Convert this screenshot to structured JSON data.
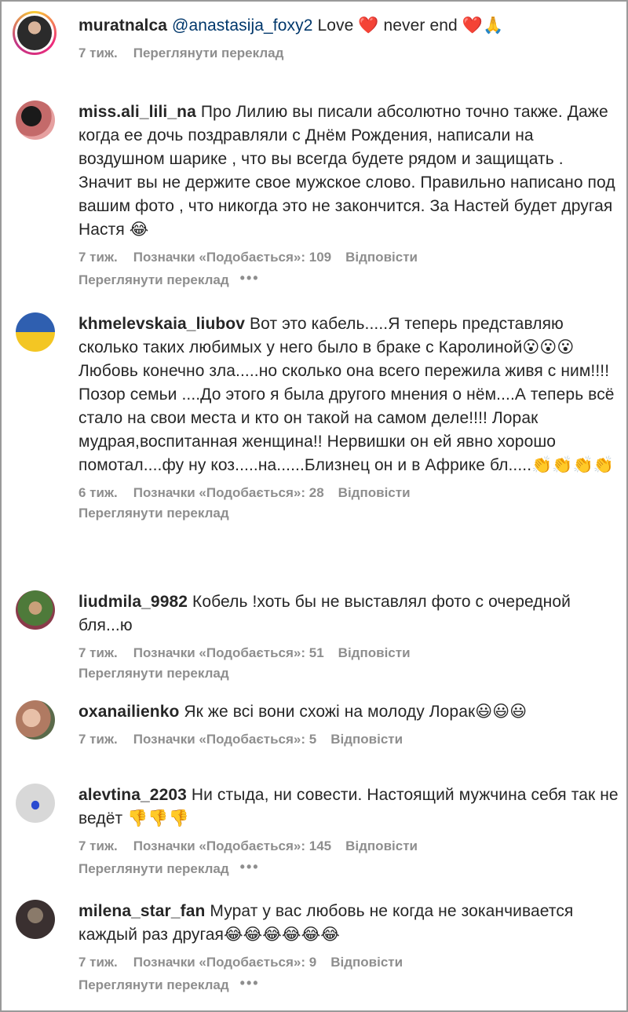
{
  "comments": [
    {
      "user": "muratnalca",
      "mention": "@anastasija_foxy2",
      "text": "Love ❤️ never end ❤️🙏",
      "time": "7 тиж.",
      "likes": "",
      "reply": "",
      "translate": "Переглянути переклад",
      "avatar_color": "#2b2b2b"
    },
    {
      "user": "miss.ali_lili_na",
      "text": "Про Лилию вы писали абсолютно точно также. Даже когда ее дочь поздравляли с Днём Рождения, написали на воздушном шарике , что вы всегда будете рядом и защищать . Значит вы не держите свое мужское слово. Правильно написано под вашим фото , что никогда это не закончится. За Настей будет другая Настя 😂",
      "time": "7 тиж.",
      "likes": "Позначки «Подобається»: 109",
      "reply": "Відповісти",
      "translate": "Переглянути переклад",
      "avatar_color": "#7a3b3b"
    },
    {
      "user": "khmelevskaia_liubov",
      "text": "Вот это кабель.....Я теперь представляю сколько таких любимых у него было в браке с Каролиной😮😮😮 Любовь конечно зла.....но сколько она всего пережила живя с ним!!!! Позор семьи ....До этого я была другого мнения о нём....А теперь всё стало на свои места и кто он такой на самом деле!!!! Лорак мудрая,воспитанная женщина!! Нервишки он ей явно хорошо помотал....фу ну коз.....на......Близнец он и в Африке бл.....👏👏👏👏",
      "time": "6 тиж.",
      "likes": "Позначки «Подобається»: 28",
      "reply": "Відповісти",
      "translate": "Переглянути переклад",
      "avatar_color": "#2f5fb0"
    },
    {
      "user": "liudmila_9982",
      "text": "Кобель !хоть бы не выставлял фото с очередной бля...ю",
      "time": "7 тиж.",
      "likes": "Позначки «Подобається»: 51",
      "reply": "Відповісти",
      "translate": "Переглянути переклад",
      "avatar_color": "#4e7a3a"
    },
    {
      "user": "oxanailienko",
      "text": "Як же всі вони схожі на молоду Лорак😃😃😃",
      "time": "7 тиж.",
      "likes": "Позначки «Подобається»: 5",
      "reply": "Відповісти",
      "translate": "",
      "avatar_color": "#b07a62"
    },
    {
      "user": "alevtina_2203",
      "text": "Ни стыда, ни совести. Настоящий мужчина себя так не ведёт 👎👎👎",
      "time": "7 тиж.",
      "likes": "Позначки «Подобається»: 145",
      "reply": "Відповісти",
      "translate": "Переглянути переклад",
      "avatar_color": "#c9c9c9"
    },
    {
      "user": "milena_star_fan",
      "text": "Мурат у вас любовь не когда не зоканчивается каждый раз другая😂😂😂😂😂😂",
      "time": "7 тиж.",
      "likes": "Позначки «Подобається»: 9",
      "reply": "Відповісти",
      "translate": "Переглянути переклад",
      "avatar_color": "#3a3030"
    }
  ],
  "colors": {
    "username": "#262626",
    "meta": "#8e8e8e",
    "mention": "#00376b",
    "heart": "#e8202f"
  },
  "icons": {
    "more": "more-dots-icon"
  }
}
